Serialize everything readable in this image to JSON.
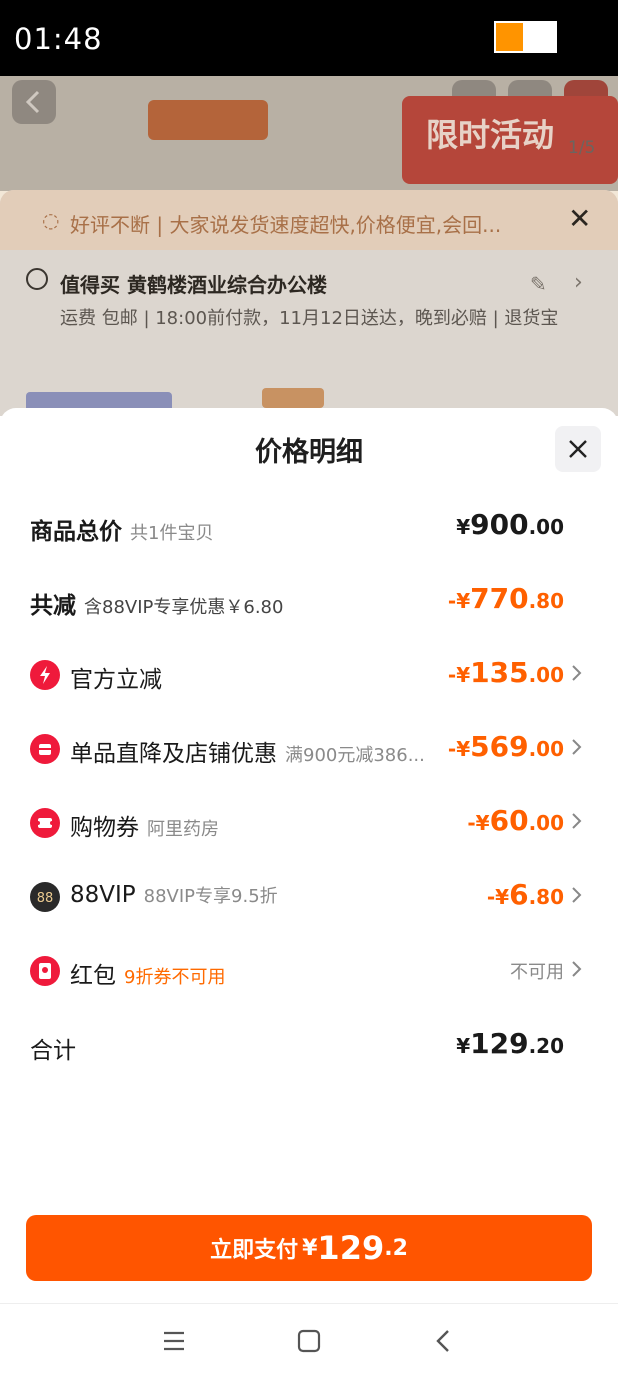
{
  "status_bar": {
    "time": "01:48",
    "battery_level": 0.45
  },
  "background_page": {
    "hero_banner_text": "限时活动",
    "image_pager": "1/5",
    "notice_text": "好评不断 | 大家说发货速度超快,价格便宜,会回...",
    "address_label": "值得买 黄鹤楼酒业综合办公楼",
    "shipping_text": "运费 包邮 | 18:00前付款，11月12日送达，晚到必赔 | 退货宝"
  },
  "modal": {
    "title": "价格明细",
    "rows": {
      "total": {
        "label": "商品总价",
        "sub": "共1件宝贝",
        "prefix": "¥",
        "int": "900",
        "dec": ".00"
      },
      "discount": {
        "label": "共减",
        "sub": "含88VIP专享优惠￥6.80",
        "prefix": "-¥",
        "int": "770",
        "dec": ".80"
      },
      "official": {
        "label": "官方立减",
        "prefix": "-¥",
        "int": "135",
        "dec": ".00",
        "icon_color": "#ef1a3b"
      },
      "single": {
        "label": "单品直降及店铺优惠",
        "sub": "满900元减386...",
        "prefix": "-¥",
        "int": "569",
        "dec": ".00",
        "icon_color": "#ef1a3b"
      },
      "coupon": {
        "label": "购物券",
        "sub": "阿里药房",
        "prefix": "-¥",
        "int": "60",
        "dec": ".00",
        "icon_color": "#ef1a3b"
      },
      "vip": {
        "label": "88VIP",
        "sub": "88VIP专享9.5折",
        "prefix": "-¥",
        "int": "6",
        "dec": ".80",
        "icon_color": "#2a2a2a"
      },
      "redpacket": {
        "label": "红包",
        "sub": "9折券不可用",
        "status": "不可用",
        "icon_color": "#ef1a3b"
      },
      "sum": {
        "label": "合计",
        "prefix": "¥",
        "int": "129",
        "dec": ".20"
      }
    }
  },
  "pay_button": {
    "label": "立即支付",
    "prefix": "¥",
    "int": "129",
    "dec": ".2"
  },
  "colors": {
    "accent": "#ff5500",
    "price_orange": "#ff6000"
  }
}
